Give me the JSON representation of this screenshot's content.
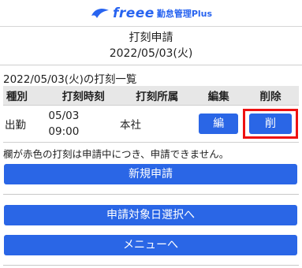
{
  "brand": {
    "name": "freee",
    "product": "勤怠管理Plus"
  },
  "title": {
    "line1": "打刻申請",
    "line2": "2022/05/03(火)"
  },
  "list_title": "2022/05/03(火)の打刻一覧",
  "table": {
    "headers": [
      "種別",
      "打刻時刻",
      "打刻所属",
      "編集",
      "削除"
    ],
    "rows": [
      {
        "kind": "出勤",
        "date": "05/03",
        "time": "09:00",
        "place": "本社",
        "edit": "編",
        "delete": "削"
      }
    ]
  },
  "note": "欄が赤色の打刻は申請中につき、申請できません。",
  "buttons": {
    "new_request": "新規申請",
    "select_date": "申請対象日選択へ",
    "menu": "メニューへ"
  },
  "colors": {
    "accent": "#2a66e6",
    "highlight": "#ee1111",
    "header_bg": "#e7e7e7"
  }
}
